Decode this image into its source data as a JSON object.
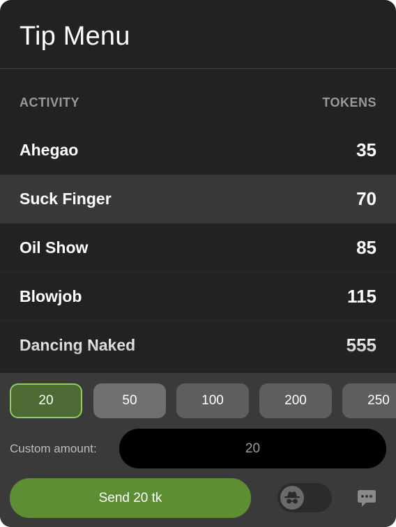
{
  "header": {
    "title": "Tip Menu"
  },
  "table": {
    "col_activity": "ACTIVITY",
    "col_tokens": "TOKENS",
    "rows": [
      {
        "name": "Ahegao",
        "tokens": "35"
      },
      {
        "name": "Suck Finger",
        "tokens": "70"
      },
      {
        "name": "Oil Show",
        "tokens": "85"
      },
      {
        "name": "Blowjob",
        "tokens": "115"
      },
      {
        "name": "Dancing Naked",
        "tokens": "555"
      }
    ]
  },
  "amounts": [
    "20",
    "50",
    "100",
    "200",
    "250"
  ],
  "custom": {
    "label": "Custom amount:",
    "value": "20"
  },
  "send": {
    "label": "Send 20 tk"
  },
  "icons": {
    "incognito": "incognito-icon",
    "chat": "chat-bubble-icon"
  },
  "colors": {
    "accent": "#5d8e33",
    "selected_border": "#8bd05d",
    "panel": "#222222"
  }
}
